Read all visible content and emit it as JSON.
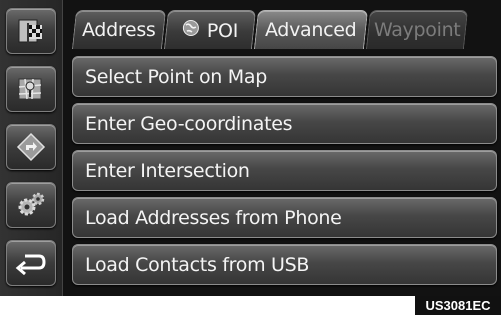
{
  "tabs": [
    {
      "label": "Address",
      "state": "normal"
    },
    {
      "label": "POI",
      "state": "normal",
      "icon": "globe-icon"
    },
    {
      "label": "Advanced",
      "state": "active"
    },
    {
      "label": "Waypoint",
      "state": "disabled"
    }
  ],
  "sidebar": {
    "items": [
      {
        "icon": "destination-flag-icon"
      },
      {
        "icon": "map-pin-icon"
      },
      {
        "icon": "route-arrow-icon"
      },
      {
        "icon": "settings-gear-icon"
      },
      {
        "icon": "back-arrow-icon"
      }
    ]
  },
  "menu": {
    "items": [
      {
        "label": "Select Point on Map"
      },
      {
        "label": "Enter Geo-coordinates"
      },
      {
        "label": "Enter Intersection"
      },
      {
        "label": "Load Addresses from Phone"
      },
      {
        "label": "Load Contacts from USB"
      }
    ]
  },
  "footer": {
    "code": "US3081EC"
  },
  "colors": {
    "screen_bg": "#121212",
    "button_face": "#474747",
    "text": "#f4f4f4",
    "disabled_text": "#7c7c7c"
  }
}
